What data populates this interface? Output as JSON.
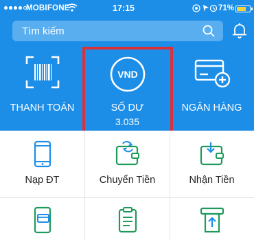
{
  "status_bar": {
    "carrier": "MOBIFONE",
    "time": "17:15",
    "battery": "71%",
    "battery_level": 0.71
  },
  "search": {
    "placeholder": "Tìm kiếm"
  },
  "actions": [
    {
      "label": "THANH TOÁN",
      "icon": "barcode-scan-icon"
    },
    {
      "label": "SỐ DƯ",
      "value": "3.035",
      "icon": "vnd-coin-icon",
      "badge": "VND"
    },
    {
      "label": "NGÂN HÀNG",
      "icon": "bank-card-add-icon"
    }
  ],
  "services": [
    {
      "label": "Nạp ĐT",
      "icon": "phone-topup-icon"
    },
    {
      "label": "Chuyển Tiền",
      "icon": "wallet-transfer-icon"
    },
    {
      "label": "Nhận Tiền",
      "icon": "wallet-receive-icon"
    },
    {
      "label": "",
      "icon": "phone-card-icon"
    },
    {
      "label": "",
      "icon": "clipboard-icon"
    },
    {
      "label": "",
      "icon": "atm-withdraw-icon"
    }
  ],
  "colors": {
    "primary": "#1c8ee8",
    "highlight": "#d9323b",
    "icon_green": "#1f9a5b",
    "icon_blue": "#1c8ee8"
  }
}
